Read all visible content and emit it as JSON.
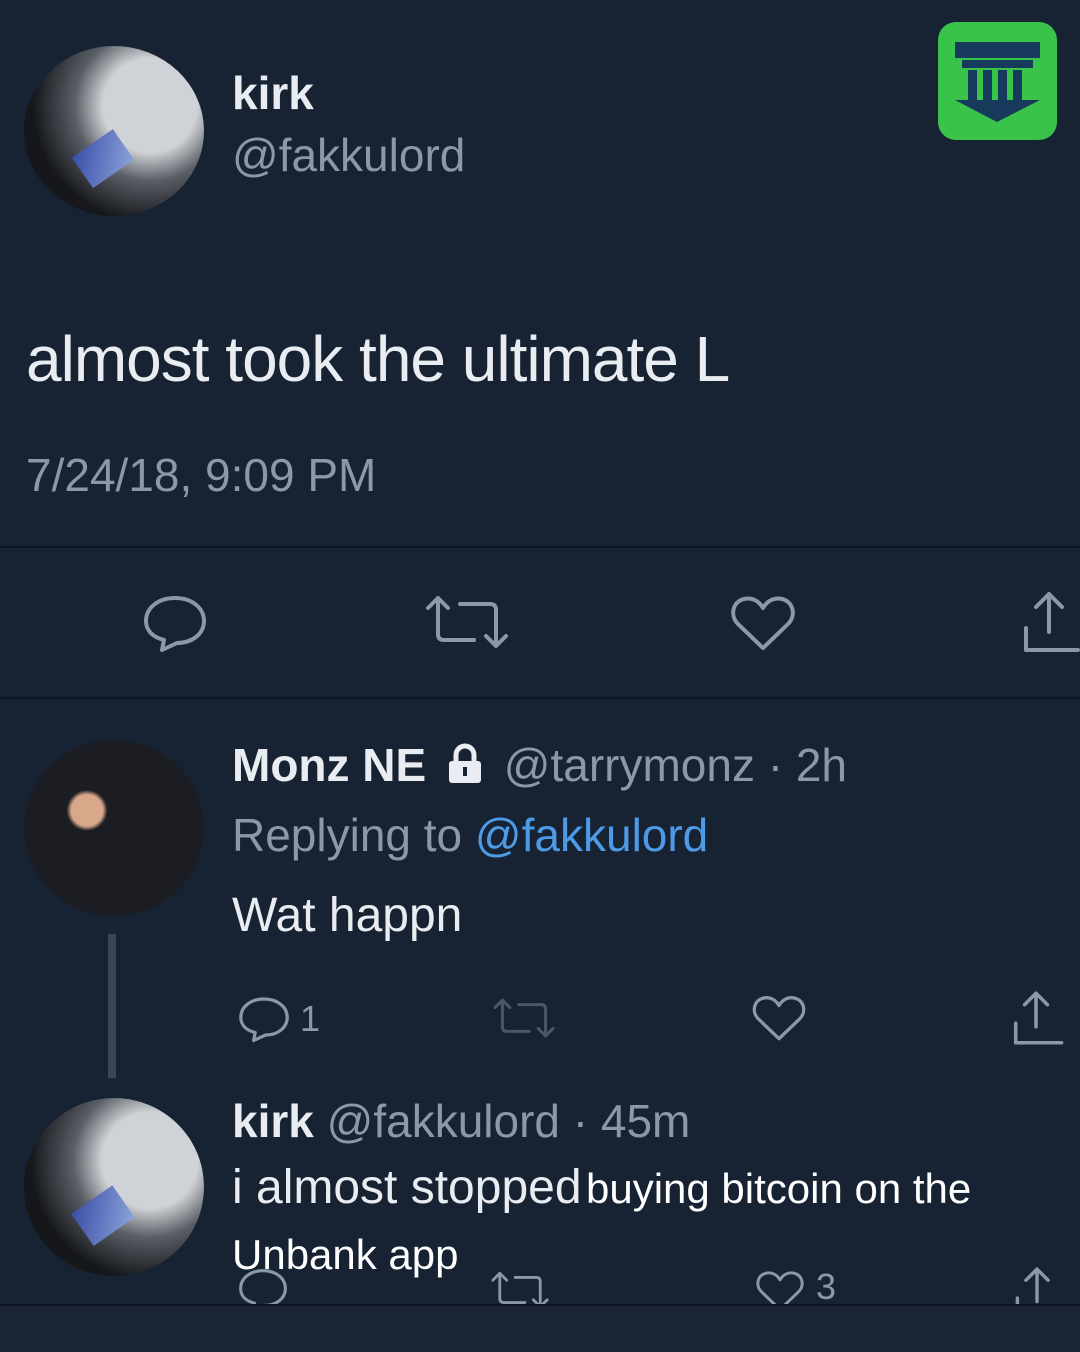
{
  "tweet": {
    "author_name": "kirk",
    "handle": "@fakkulord",
    "text": "almost took the ultimate L",
    "timestamp": "7/24/18, 9:09 PM",
    "icons": [
      "reply-icon",
      "retweet-icon",
      "like-icon",
      "share-icon"
    ]
  },
  "reply1": {
    "author_name": "Monz NE",
    "lock_icon": "lock-icon",
    "handle": "@tarrymonz",
    "time": "· 2h",
    "replying_label": "Replying to",
    "replying_handle": "@fakkulord",
    "text": "Wat happn",
    "reply_count": "1"
  },
  "reply2": {
    "author_name": "kirk",
    "handle": "@fakkulord",
    "time": "· 45m",
    "text_part1": "i almost stopped",
    "text_part2": "buying bitcoin on the",
    "text_part3": "Unbank app",
    "like_count": "3"
  },
  "brand": {
    "logo": "unbank-bank-icon",
    "accent": "#39c34b"
  }
}
